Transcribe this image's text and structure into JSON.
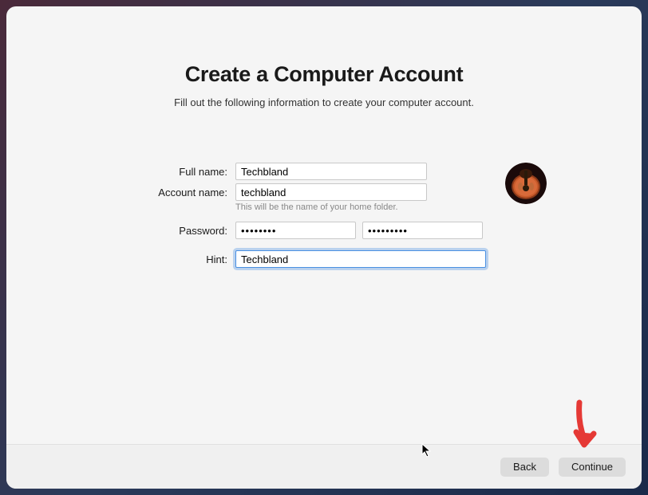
{
  "title": "Create a Computer Account",
  "subtitle": "Fill out the following information to create your computer account.",
  "form": {
    "fullname_label": "Full name:",
    "fullname_value": "Techbland",
    "accountname_label": "Account name:",
    "accountname_value": "techbland",
    "accountname_note": "This will be the name of your home folder.",
    "password_label": "Password:",
    "password_value": "••••••••",
    "password_verify_value": "•••••••••",
    "hint_label": "Hint:",
    "hint_value": "Techbland"
  },
  "buttons": {
    "back": "Back",
    "continue": "Continue"
  },
  "avatar": {
    "name": "guitar-avatar"
  }
}
